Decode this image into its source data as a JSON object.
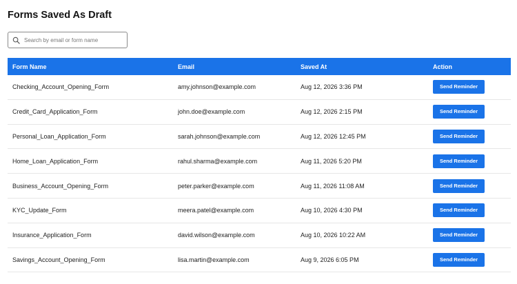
{
  "page": {
    "title": "Forms Saved As Draft"
  },
  "search": {
    "placeholder": "Search by email or form name",
    "icon": "search-icon"
  },
  "table": {
    "headers": [
      "Form Name",
      "Email",
      "Saved At",
      "Action"
    ],
    "rows": [
      {
        "form_name": "Checking_Account_Opening_Form",
        "email": "amy.johnson@example.com",
        "saved_at": "Aug 12, 2026 3:36 PM",
        "action": "Send Reminder"
      },
      {
        "form_name": "Credit_Card_Application_Form",
        "email": "john.doe@example.com",
        "saved_at": "Aug 12, 2026 2:15 PM",
        "action": "Send Reminder"
      },
      {
        "form_name": "Personal_Loan_Application_Form",
        "email": "sarah.johnson@example.com",
        "saved_at": "Aug 12, 2026 12:45 PM",
        "action": "Send Reminder"
      },
      {
        "form_name": "Home_Loan_Application_Form",
        "email": "rahul.sharma@example.com",
        "saved_at": "Aug 11, 2026 5:20 PM",
        "action": "Send Reminder"
      },
      {
        "form_name": "Business_Account_Opening_Form",
        "email": "peter.parker@example.com",
        "saved_at": "Aug 11, 2026 11:08 AM",
        "action": "Send Reminder"
      },
      {
        "form_name": "KYC_Update_Form",
        "email": "meera.patel@example.com",
        "saved_at": "Aug 10, 2026 4:30 PM",
        "action": "Send Reminder"
      },
      {
        "form_name": "Insurance_Application_Form",
        "email": "david.wilson@example.com",
        "saved_at": "Aug 10, 2026 10:22 AM",
        "action": "Send Reminder"
      },
      {
        "form_name": "Savings_Account_Opening_Form",
        "email": "lisa.martin@example.com",
        "saved_at": "Aug 9, 2026 6:05 PM",
        "action": "Send Reminder"
      }
    ]
  },
  "colors": {
    "header_bg": "#1a73e8",
    "button_bg": "#1a73e8"
  }
}
